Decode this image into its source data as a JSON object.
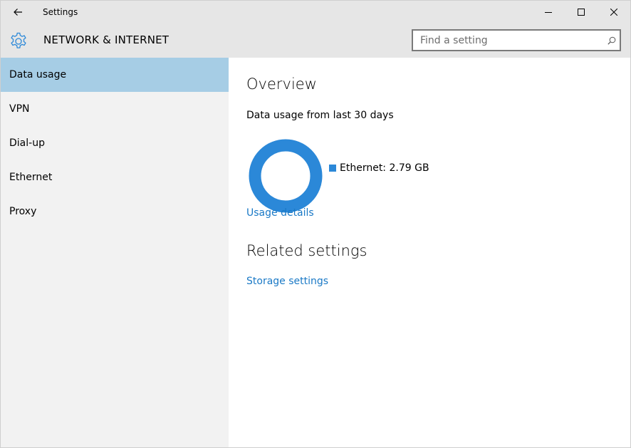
{
  "window": {
    "title": "Settings"
  },
  "header": {
    "title": "NETWORK & INTERNET"
  },
  "search": {
    "placeholder": "Find a setting"
  },
  "sidebar": {
    "items": [
      {
        "label": "Data usage",
        "selected": true
      },
      {
        "label": "VPN",
        "selected": false
      },
      {
        "label": "Dial-up",
        "selected": false
      },
      {
        "label": "Ethernet",
        "selected": false
      },
      {
        "label": "Proxy",
        "selected": false
      }
    ]
  },
  "main": {
    "overview_title": "Overview",
    "usage_subtitle": "Data usage from last 30 days",
    "legend_label": "Ethernet: 2.79 GB",
    "usage_details_link": "Usage details",
    "related_title": "Related settings",
    "storage_link": "Storage settings"
  },
  "colors": {
    "accent": "#2b88d8",
    "link": "#1a79c6",
    "selection": "#a6cde5",
    "sidebar_bg": "#f2f2f2",
    "header_bg": "#e6e6e6"
  },
  "icons": {
    "back": "back-arrow-icon",
    "minimize": "minimize-icon",
    "maximize": "maximize-icon",
    "close": "close-icon",
    "gear": "gear-icon",
    "search": "search-icon"
  },
  "chart_data": {
    "type": "pie",
    "categories": [
      "Ethernet"
    ],
    "values": [
      2.79
    ]
  }
}
